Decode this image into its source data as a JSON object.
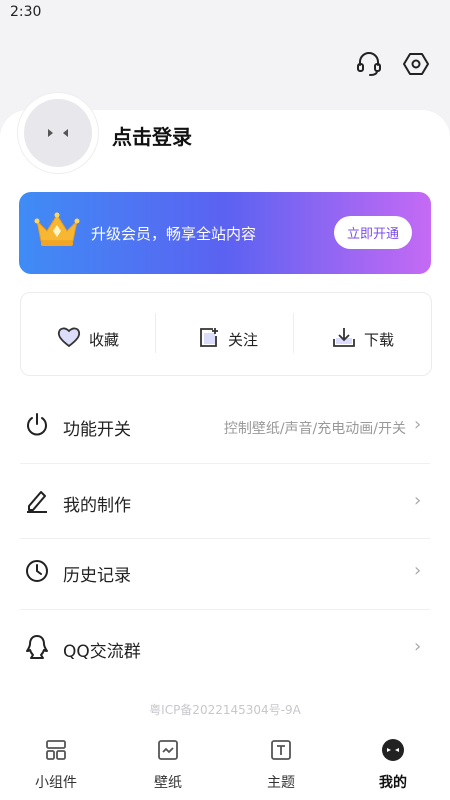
{
  "status": {
    "time": "2:30"
  },
  "header": {
    "support_icon": "headset-icon",
    "settings_icon": "settings-hex-icon"
  },
  "profile": {
    "login_text": "点击登录",
    "avatar_icon": "default-avatar-icon"
  },
  "vip": {
    "text": "升级会员，畅享全站内容",
    "button": "立即开通",
    "crown_icon": "crown-icon",
    "gradient": [
      "#3f8cf5",
      "#5b62f1",
      "#c56af4"
    ]
  },
  "quick_actions": [
    {
      "label": "收藏",
      "icon": "heart-icon"
    },
    {
      "label": "关注",
      "icon": "follow-icon"
    },
    {
      "label": "下载",
      "icon": "download-icon"
    }
  ],
  "menu": [
    {
      "label": "功能开关",
      "sub": "控制壁纸/声音/充电动画/开关",
      "icon": "power-icon"
    },
    {
      "label": "我的制作",
      "sub": "",
      "icon": "pen-icon"
    },
    {
      "label": "历史记录",
      "sub": "",
      "icon": "clock-icon"
    },
    {
      "label": "QQ交流群",
      "sub": "",
      "icon": "qq-icon"
    }
  ],
  "footer": {
    "icp": "粤ICP备2022145304号-9A"
  },
  "tabs": [
    {
      "label": "小组件",
      "icon": "widget-icon",
      "active": false
    },
    {
      "label": "壁纸",
      "icon": "wallpaper-icon",
      "active": false
    },
    {
      "label": "主题",
      "icon": "theme-icon",
      "active": false
    },
    {
      "label": "我的",
      "icon": "me-icon",
      "active": true
    }
  ]
}
